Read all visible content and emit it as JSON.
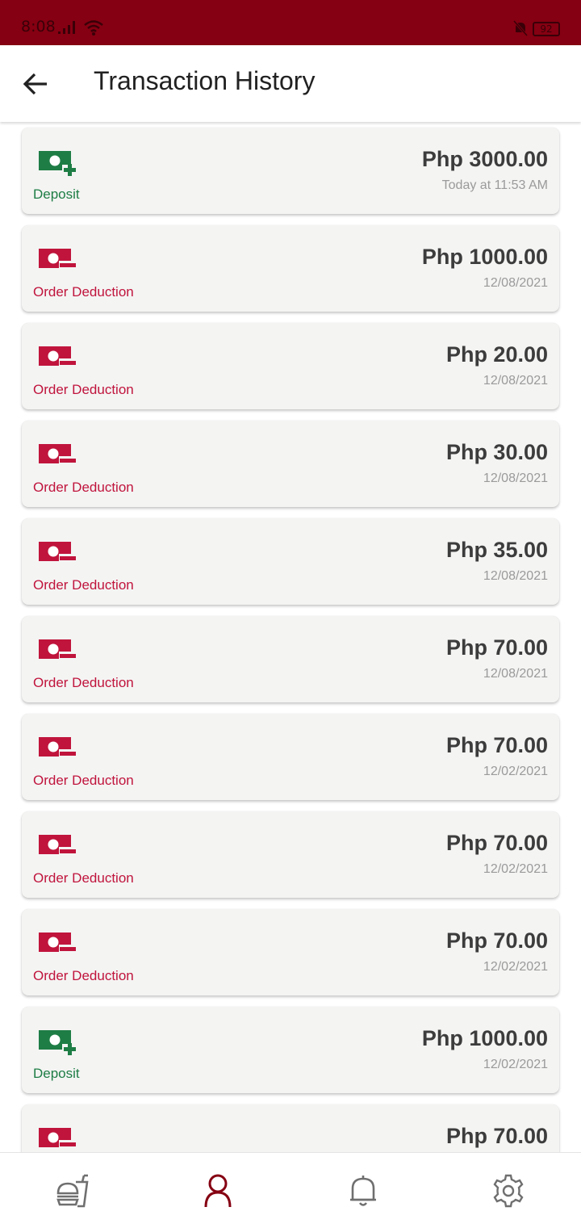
{
  "status_bar": {
    "time": "8:08",
    "battery": "92"
  },
  "header": {
    "title": "Transaction History",
    "back_icon": "arrow-left-icon"
  },
  "colors": {
    "brand": "#850012",
    "deposit": "#1e7d45",
    "deduction": "#c0143c",
    "nav_active": "#850012",
    "nav_inactive": "#6f6f6f"
  },
  "transactions": [
    {
      "type": "deposit",
      "label": "Deposit",
      "amount": "Php 3000.00",
      "date": "Today at 11:53 AM",
      "icon": "money-plus-icon"
    },
    {
      "type": "deduction",
      "label": "Order Deduction",
      "amount": "Php 1000.00",
      "date": "12/08/2021",
      "icon": "money-minus-icon"
    },
    {
      "type": "deduction",
      "label": "Order Deduction",
      "amount": "Php 20.00",
      "date": "12/08/2021",
      "icon": "money-minus-icon"
    },
    {
      "type": "deduction",
      "label": "Order Deduction",
      "amount": "Php 30.00",
      "date": "12/08/2021",
      "icon": "money-minus-icon"
    },
    {
      "type": "deduction",
      "label": "Order Deduction",
      "amount": "Php 35.00",
      "date": "12/08/2021",
      "icon": "money-minus-icon"
    },
    {
      "type": "deduction",
      "label": "Order Deduction",
      "amount": "Php 70.00",
      "date": "12/08/2021",
      "icon": "money-minus-icon"
    },
    {
      "type": "deduction",
      "label": "Order Deduction",
      "amount": "Php 70.00",
      "date": "12/02/2021",
      "icon": "money-minus-icon"
    },
    {
      "type": "deduction",
      "label": "Order Deduction",
      "amount": "Php 70.00",
      "date": "12/02/2021",
      "icon": "money-minus-icon"
    },
    {
      "type": "deduction",
      "label": "Order Deduction",
      "amount": "Php 70.00",
      "date": "12/02/2021",
      "icon": "money-minus-icon"
    },
    {
      "type": "deposit",
      "label": "Deposit",
      "amount": "Php 1000.00",
      "date": "12/02/2021",
      "icon": "money-plus-icon"
    },
    {
      "type": "deduction",
      "label": "",
      "amount": "Php 70.00",
      "date": "",
      "icon": "money-minus-icon"
    }
  ],
  "bottom_nav": [
    {
      "name": "food-icon",
      "active": false
    },
    {
      "name": "profile-icon",
      "active": true
    },
    {
      "name": "bell-icon",
      "active": false
    },
    {
      "name": "settings-icon",
      "active": false
    }
  ]
}
